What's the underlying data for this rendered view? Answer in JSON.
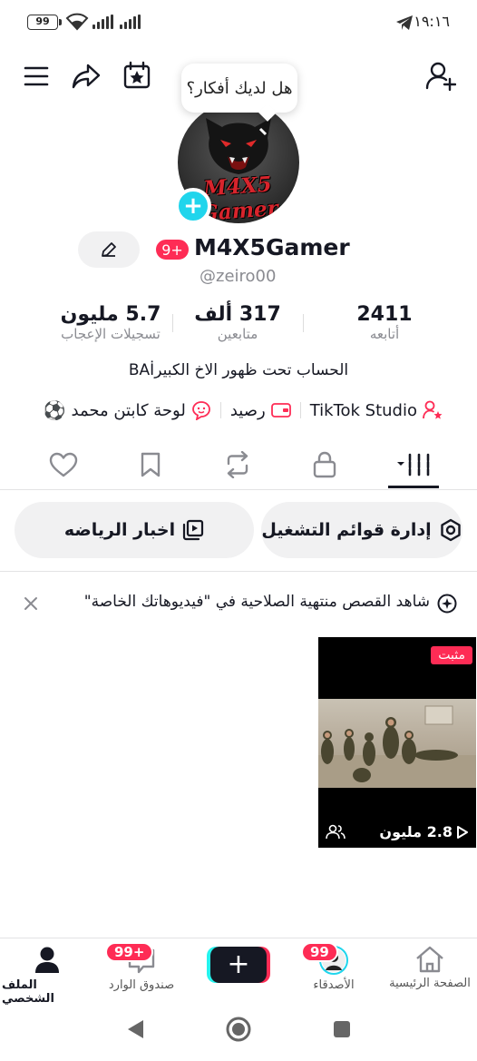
{
  "status_bar": {
    "battery": "99",
    "time": "١٩:١٦"
  },
  "tooltip": "هل لديك أفكار؟",
  "avatar_text": "M4X5 Gamer",
  "profile": {
    "nickname": "M4X5Gamer",
    "nickname_badge": "9+",
    "username": "@zeiro00"
  },
  "stats": {
    "following": {
      "value": "2411",
      "label": "أتابعه"
    },
    "followers": {
      "value": "317 ألف",
      "label": "متابعين"
    },
    "likes": {
      "value": "5.7 مليون",
      "label": "تسجيلات الإعجاب"
    }
  },
  "bio": "الحساب تحت ظهور الاخ الكبيرBAİ",
  "links": {
    "studio": "TikTok Studio",
    "balance": "رصيد",
    "board": "لوحة كابتن محمد",
    "board_emoji": "⚽"
  },
  "pills": {
    "playlists": "إدارة قوائم التشغيل",
    "sports": "اخبار الرياضه"
  },
  "notice": "شاهد القصص منتهية الصلاحية في \"فيديوهاتك الخاصة\"",
  "video": {
    "pinned_label": "مثبت",
    "views": "2.8 مليون"
  },
  "bottom_nav": {
    "home": "الصفحة الرئيسية",
    "friends": "الأصدقاء",
    "friends_badge": "99",
    "inbox": "صندوق الوارد",
    "inbox_badge": "99+",
    "profile": "الملف الشخصي"
  },
  "colors": {
    "accent": "#fe2c55",
    "cyan": "#20d5ec",
    "text": "#161823",
    "muted": "#8a8b91"
  }
}
